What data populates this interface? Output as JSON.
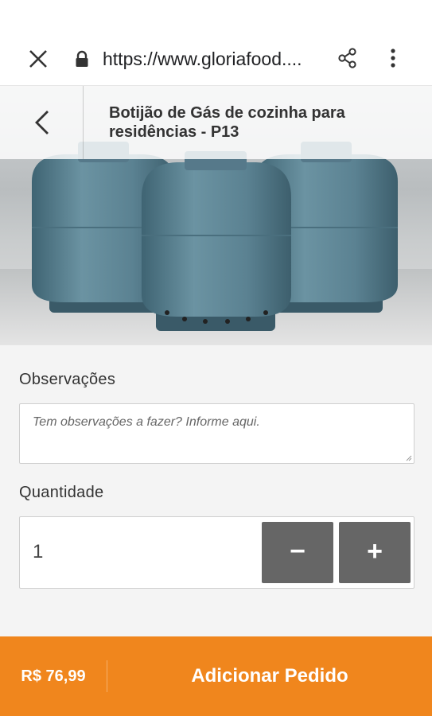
{
  "browser": {
    "url": "https://www.gloriafood....",
    "icons": {
      "close": "close-icon",
      "lock": "lock-icon",
      "share": "share-icon",
      "menu": "more-vert-icon"
    }
  },
  "product": {
    "title": "Botijão de Gás de cozinha para residências - P13",
    "image": "gas-cylinder-photo",
    "back_icon": "chevron-left-icon"
  },
  "form": {
    "notes_label": "Observações",
    "notes_placeholder": "Tem observações a fazer?  Informe aqui.",
    "quantity_label": "Quantidade",
    "quantity_value": "1",
    "decrement_label": "−",
    "increment_label": "+"
  },
  "order": {
    "price": "R$ 76,99",
    "add_label": "Adicionar Pedido"
  },
  "colors": {
    "accent": "#f0861d",
    "stepper": "#666666",
    "cylinder": "#5f8696"
  }
}
